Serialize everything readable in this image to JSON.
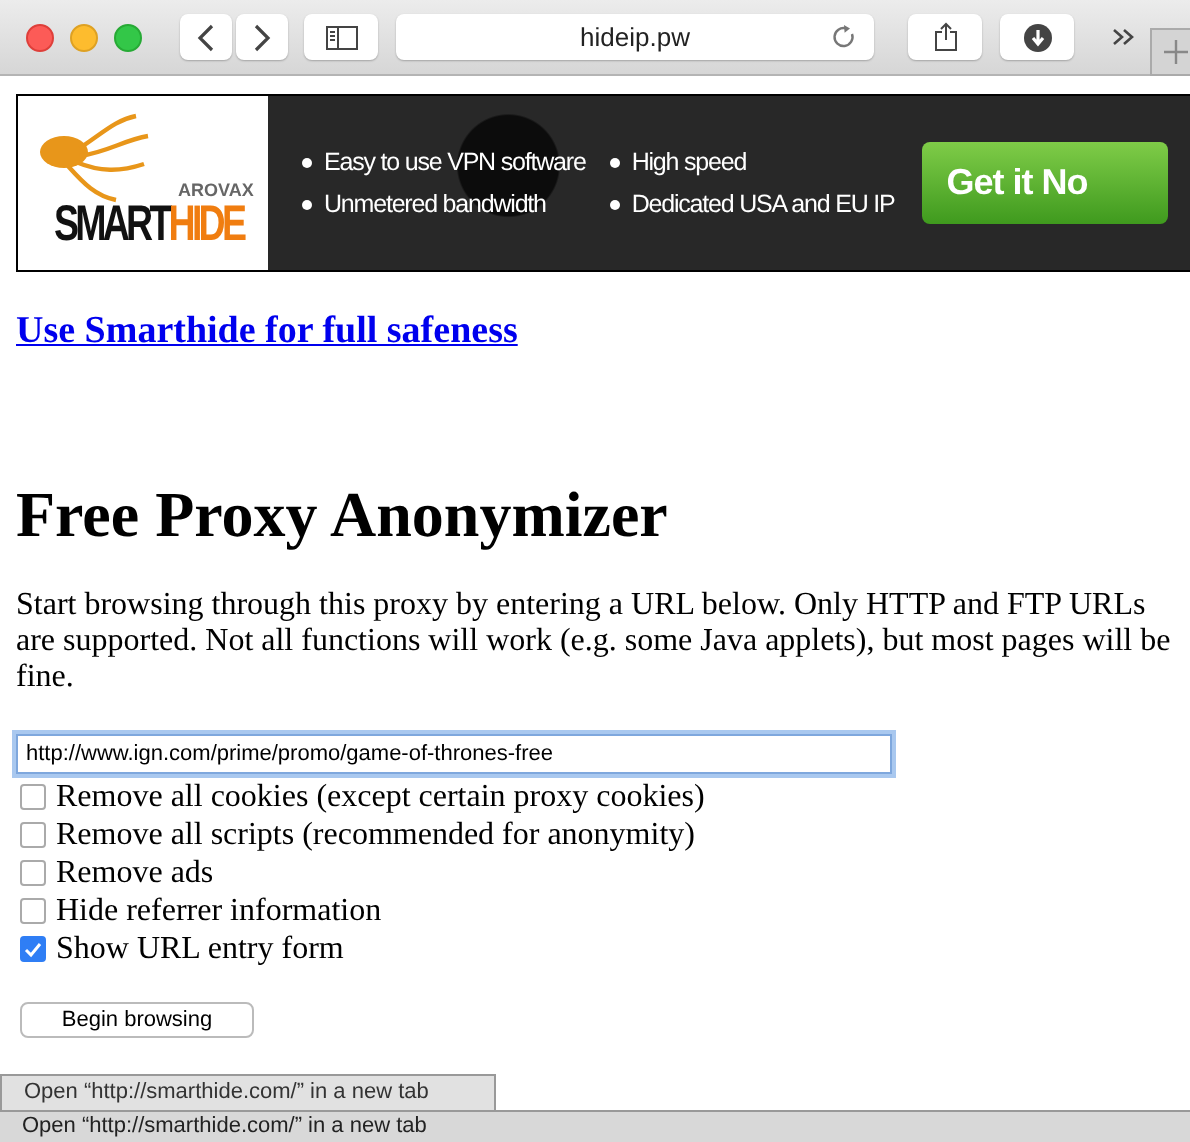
{
  "browser": {
    "address": "hideip.pw"
  },
  "banner": {
    "logo": {
      "tagline": "AROVAX",
      "word_1": "SMART",
      "word_2": "HIDE"
    },
    "features": [
      "Easy to use VPN software",
      "High speed",
      "Unmetered bandwidth",
      "Dedicated USA and EU IP"
    ],
    "cta": "Get it No"
  },
  "promo_link": "Use Smarthide for full safeness",
  "heading": "Free Proxy Anonymizer",
  "intro": "Start browsing through this proxy by entering a URL below. Only HTTP and FTP URLs are supported. Not all functions will work (e.g. some Java applets), but most pages will be fine.",
  "url_field": {
    "value": "http://www.ign.com/prime/promo/game-of-thrones-free",
    "focused": true
  },
  "options": [
    {
      "label": "Remove all cookies (except certain proxy cookies)",
      "checked": false
    },
    {
      "label": "Remove all scripts (recommended for anonymity)",
      "checked": false
    },
    {
      "label": "Remove ads",
      "checked": false
    },
    {
      "label": "Hide referrer information",
      "checked": false
    },
    {
      "label": "Show URL entry form",
      "checked": true
    }
  ],
  "submit_button": "Begin browsing",
  "link_tooltip": "Open “http://smarthide.com/” in a new tab",
  "status_bar": "Open “http://smarthide.com/” in a new tab"
}
